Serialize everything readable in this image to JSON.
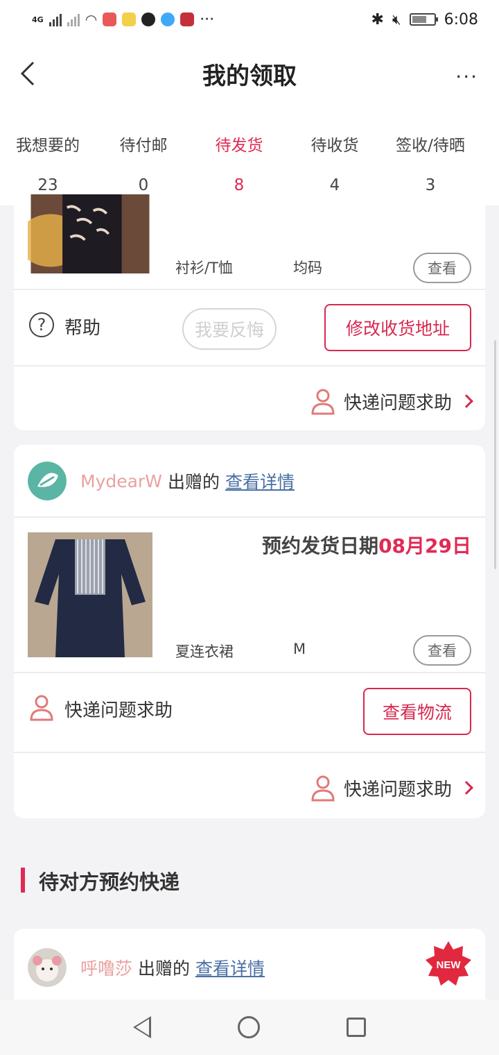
{
  "status_bar": {
    "network": "4G",
    "time": "6:08",
    "more": "···"
  },
  "header": {
    "title": "我的领取",
    "back_icon": "chevron-left-icon",
    "more_icon": "more-dots-icon",
    "more_label": "···"
  },
  "tabs": [
    {
      "label": "我想要的",
      "count": "23"
    },
    {
      "label": "待付邮",
      "count": "0"
    },
    {
      "label": "待发货",
      "count": "8"
    },
    {
      "label": "待收货",
      "count": "4"
    },
    {
      "label": "签收/待晒",
      "count": "3"
    }
  ],
  "card1": {
    "category": "衬衫/T恤",
    "size": "均码",
    "view_label": "查看",
    "help_label": "帮助",
    "regret_label": "我要反悔",
    "change_address_label": "修改收货地址",
    "express_help": "快递问题求助"
  },
  "card2": {
    "giver_name": "MydearW",
    "giver_suffix": "出赠的",
    "detail_link": "查看详情",
    "ship_date_label": "预约发货日期",
    "ship_date_value": "08月29日",
    "category": "夏连衣裙",
    "size": "M",
    "view_label": "查看",
    "express_help_inline": "快递问题求助",
    "logistics_label": "查看物流",
    "express_help": "快递问题求助"
  },
  "section": {
    "title": "待对方预约快递"
  },
  "card3": {
    "giver_name": "呼噜莎",
    "giver_suffix": "出赠的",
    "detail_link": "查看详情",
    "badge": "NEW"
  },
  "colors": {
    "accent": "#e02a55",
    "link": "#4a6fa5",
    "giver_name": "#eaa0a0"
  }
}
